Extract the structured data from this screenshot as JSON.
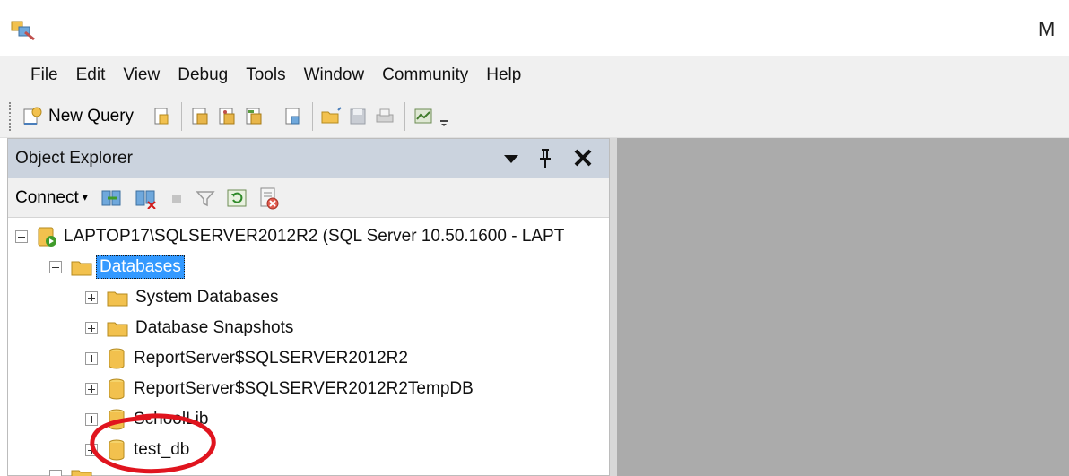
{
  "window": {
    "title_fragment": "M"
  },
  "menu": [
    "File",
    "Edit",
    "View",
    "Debug",
    "Tools",
    "Window",
    "Community",
    "Help"
  ],
  "toolbar": {
    "new_query_label": "New Query"
  },
  "object_explorer": {
    "title": "Object Explorer",
    "connect_label": "Connect",
    "server_label": "LAPTOP17\\SQLSERVER2012R2 (SQL Server 10.50.1600 - LAPT",
    "databases_label": "Databases",
    "children": [
      {
        "label": "System Databases",
        "type": "folder"
      },
      {
        "label": "Database Snapshots",
        "type": "folder"
      },
      {
        "label": "ReportServer$SQLSERVER2012R2",
        "type": "database"
      },
      {
        "label": "ReportServer$SQLSERVER2012R2TempDB",
        "type": "database"
      },
      {
        "label": "SchoolLib",
        "type": "database"
      },
      {
        "label": "test_db",
        "type": "database"
      }
    ]
  },
  "colors": {
    "selection": "#3399ff",
    "annotation": "#e0141e",
    "right_pane": "#ababab"
  }
}
